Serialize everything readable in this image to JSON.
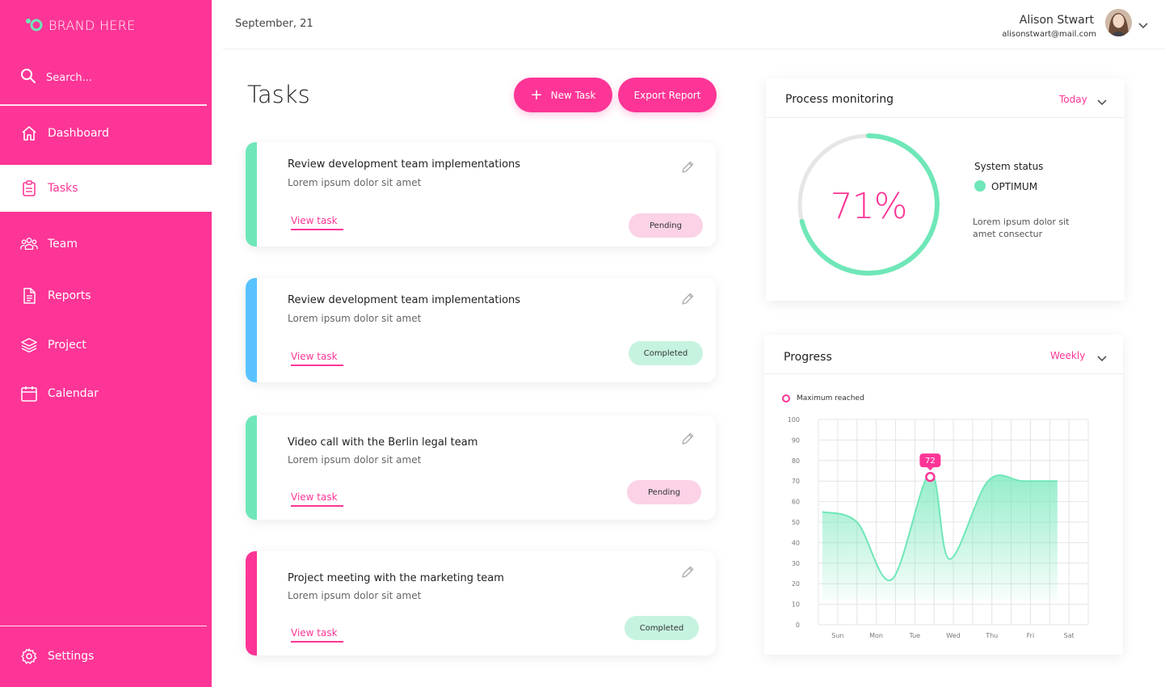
{
  "brand": {
    "name": "BRAND HERE"
  },
  "search": {
    "placeholder": "Search..."
  },
  "sidebar": {
    "items": [
      {
        "label": "Dashboard",
        "icon": "home-icon"
      },
      {
        "label": "Tasks",
        "icon": "clipboard-icon",
        "active": true
      },
      {
        "label": "Team",
        "icon": "team-icon"
      },
      {
        "label": "Reports",
        "icon": "document-icon"
      },
      {
        "label": "Project",
        "icon": "layers-icon"
      },
      {
        "label": "Calendar",
        "icon": "calendar-icon"
      }
    ],
    "settings_label": "Settings"
  },
  "header": {
    "date": "September, 21",
    "user_name": "Alison Stwart",
    "user_email": "alisonstwart@mail.com"
  },
  "main": {
    "title": "Tasks",
    "new_task_label": "New Task",
    "export_label": "Export Report",
    "tasks": [
      {
        "title": "Review development team implementations",
        "subtitle": "Lorem ipsum dolor sit amet",
        "link": "View task",
        "status": "Pending",
        "accent": "#6fe7b8"
      },
      {
        "title": "Review development team implementations",
        "subtitle": "Lorem ipsum dolor sit amet",
        "link": "View task",
        "status": "Completed",
        "accent": "#59c3ff"
      },
      {
        "title": "Video call with the Berlin legal team",
        "subtitle": "Lorem ipsum dolor sit amet",
        "link": "View task",
        "status": "Pending",
        "accent": "#6fe7b8"
      },
      {
        "title": "Project meeting with the marketing team",
        "subtitle": "Lorem ipsum dolor sit amet",
        "link": "View task",
        "status": "Completed",
        "accent": "#fd3596"
      }
    ]
  },
  "process": {
    "title": "Process monitoring",
    "filter": "Today",
    "percent": 71,
    "percent_label": "71%",
    "status_label": "System status",
    "status_value": "OPTIMUM",
    "description": "Lorem ipsum dolor sit amet consectur"
  },
  "progress": {
    "title": "Progress",
    "filter": "Weekly",
    "legend": "Maximum reached",
    "max_label": "72"
  },
  "colors": {
    "brand": "#fd3596",
    "mint": "#6fe7b8",
    "blue": "#59c3ff"
  },
  "chart_data": {
    "type": "area",
    "categories": [
      "Sun",
      "Mon",
      "Tue",
      "Wed",
      "Thu",
      "Fri",
      "Sat"
    ],
    "x_positions": [
      0,
      1,
      2,
      3,
      4,
      5,
      6
    ],
    "curve_x": [
      -0.4,
      0.5,
      1.4,
      2.4,
      2.9,
      3.9,
      4.8,
      5.7
    ],
    "curve_y": [
      55,
      50,
      22,
      74,
      32,
      70,
      70,
      70
    ],
    "ylim": [
      0,
      100
    ],
    "yticks": [
      0,
      10,
      20,
      30,
      40,
      50,
      60,
      70,
      80,
      90,
      100
    ],
    "max_point": {
      "x": 2.4,
      "y": 72
    },
    "grid": true
  }
}
